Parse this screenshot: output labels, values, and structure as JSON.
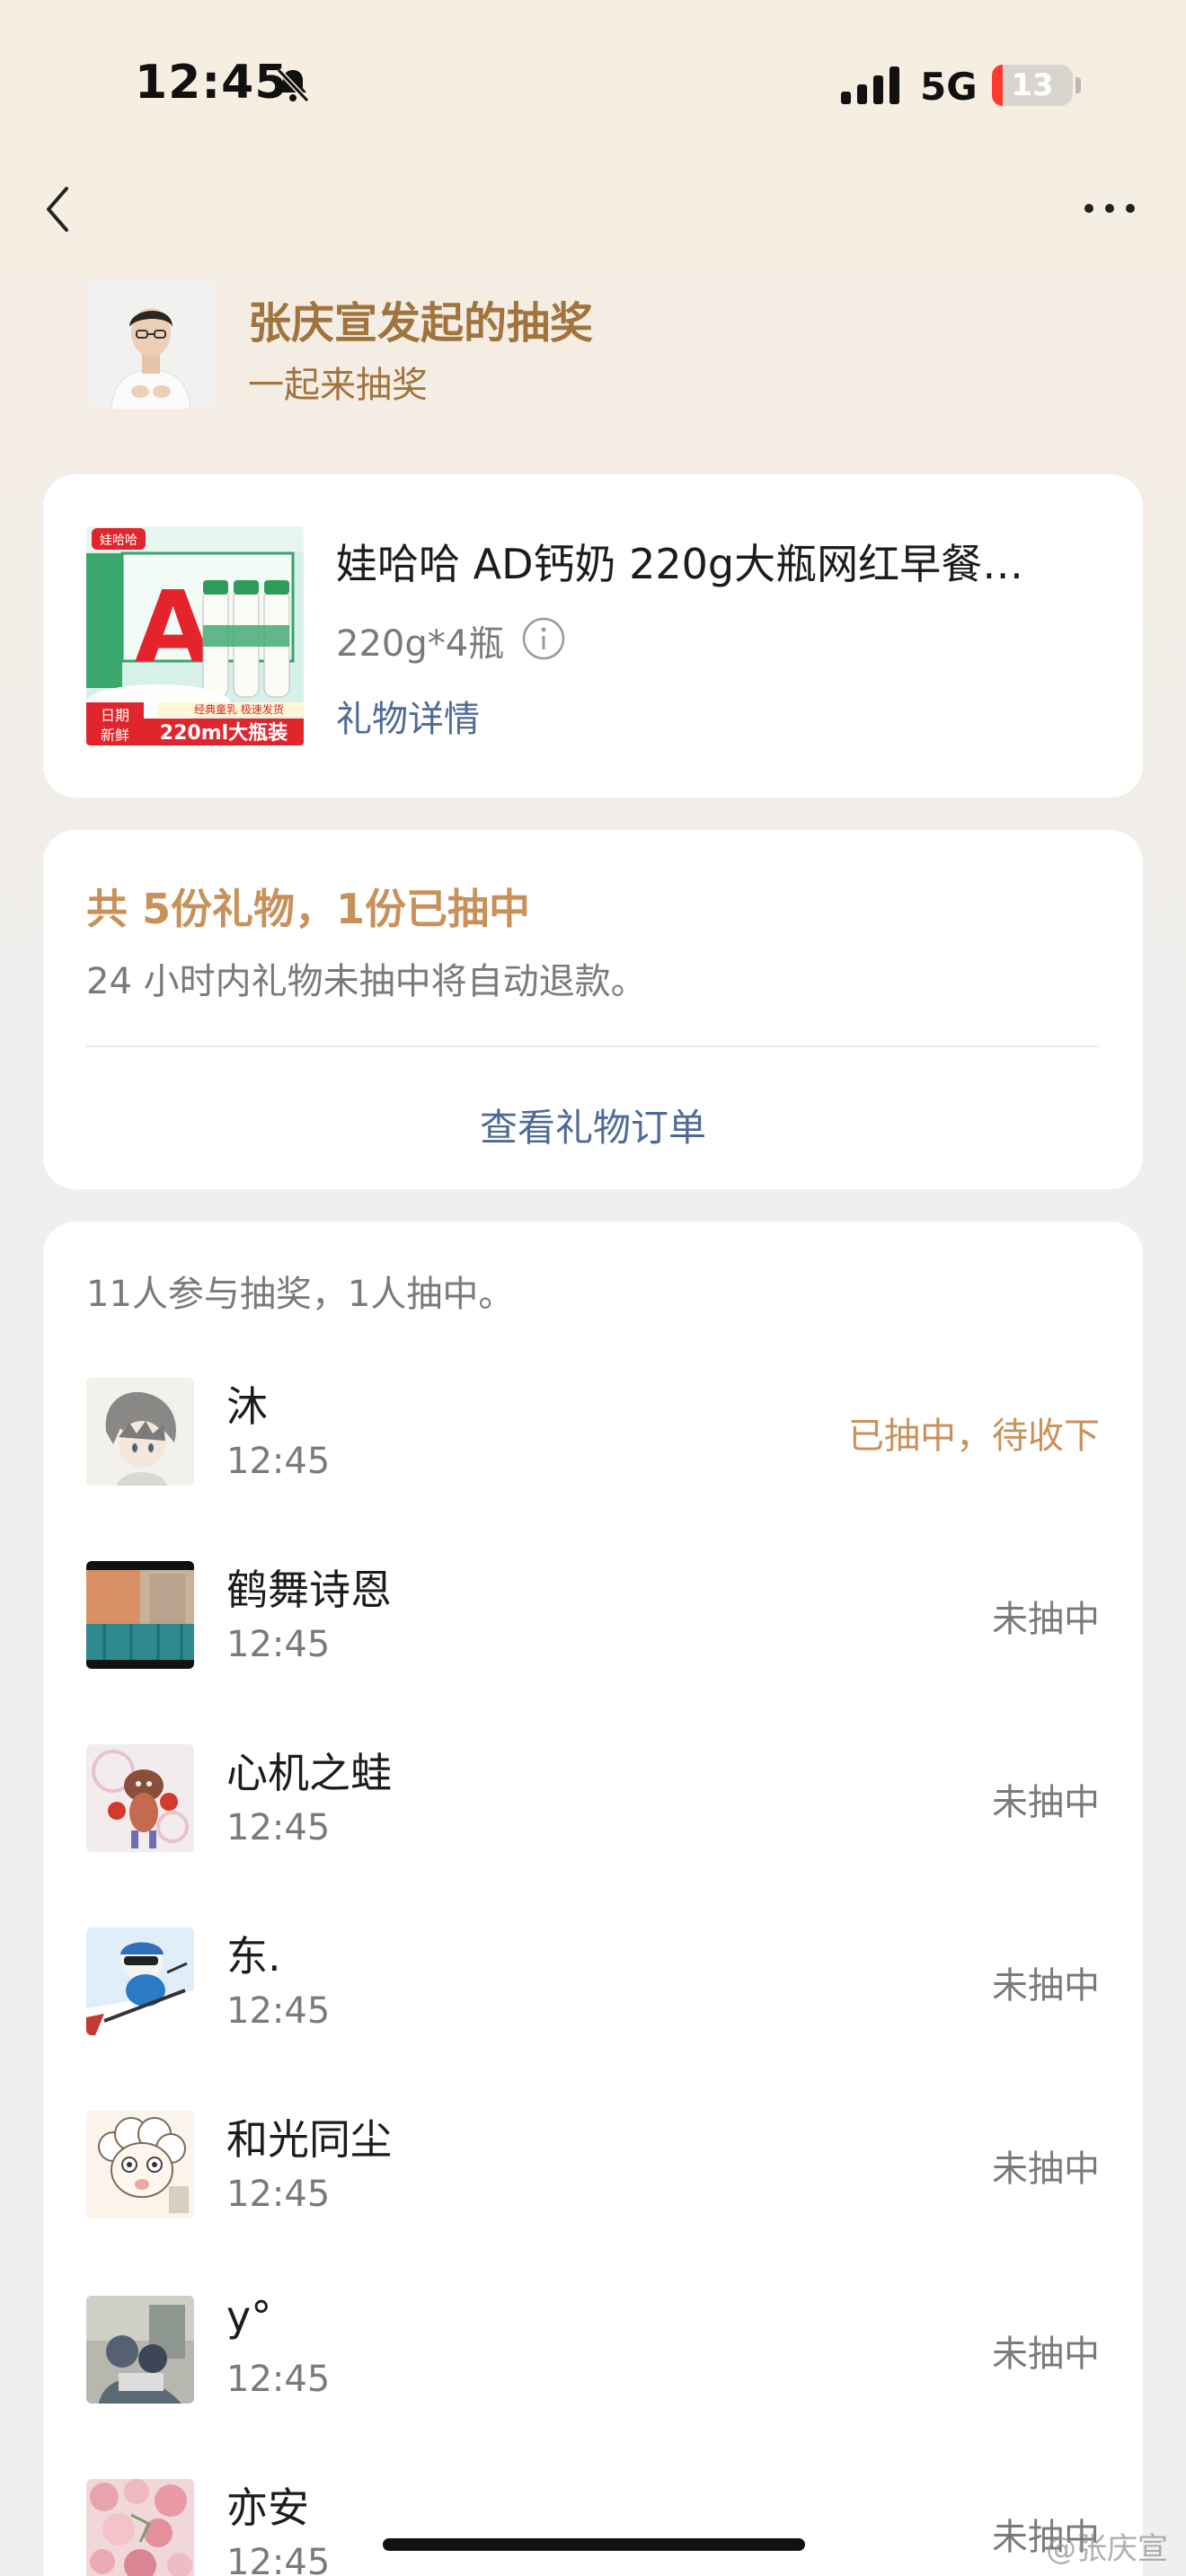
{
  "status_bar": {
    "time": "12:45",
    "network": "5G",
    "battery": "13",
    "battery_fraction": 0.13
  },
  "nav": {
    "back_icon": "chevron-left-icon",
    "more_icon": "more-horizontal-icon"
  },
  "host": {
    "title": "张庆宣发起的抽奖",
    "subtitle": "一起来抽奖"
  },
  "gift": {
    "name": "娃哈哈 AD钙奶 220g大瓶网红早餐…",
    "spec": "220g*4瓶",
    "detail_link": "礼物详情",
    "image_text": {
      "brand": "娃哈哈",
      "banner": "220ml大瓶装",
      "tag_line1": "日期",
      "tag_line2": "新鲜",
      "promo": "经典童乳 极速发货",
      "letter": "A"
    }
  },
  "summary": {
    "title": "共 5份礼物，1份已抽中",
    "note": "24 小时内礼物未抽中将自动退款。",
    "orders_link": "查看礼物订单"
  },
  "participants": {
    "header": "11人参与抽奖，1人抽中。",
    "items": [
      {
        "name": "沐",
        "time": "12:45",
        "status": "已抽中，待收下",
        "won": true
      },
      {
        "name": "鹤舞诗恩",
        "time": "12:45",
        "status": "未抽中",
        "won": false
      },
      {
        "name": "心机之蛙",
        "time": "12:45",
        "status": "未抽中",
        "won": false
      },
      {
        "name": "东.",
        "time": "12:45",
        "status": "未抽中",
        "won": false
      },
      {
        "name": "和光同尘",
        "time": "12:45",
        "status": "未抽中",
        "won": false
      },
      {
        "name": "y°",
        "time": "12:45",
        "status": "未抽中",
        "won": false
      },
      {
        "name": "亦安",
        "time": "12:45",
        "status": "未抽中",
        "won": false
      }
    ]
  },
  "watermark": "@张庆宣",
  "colors": {
    "accent_gold": "#c8915a",
    "host_gold": "#a1733d",
    "link_blue": "#4e6a99",
    "battery_red": "#ff3b30"
  }
}
